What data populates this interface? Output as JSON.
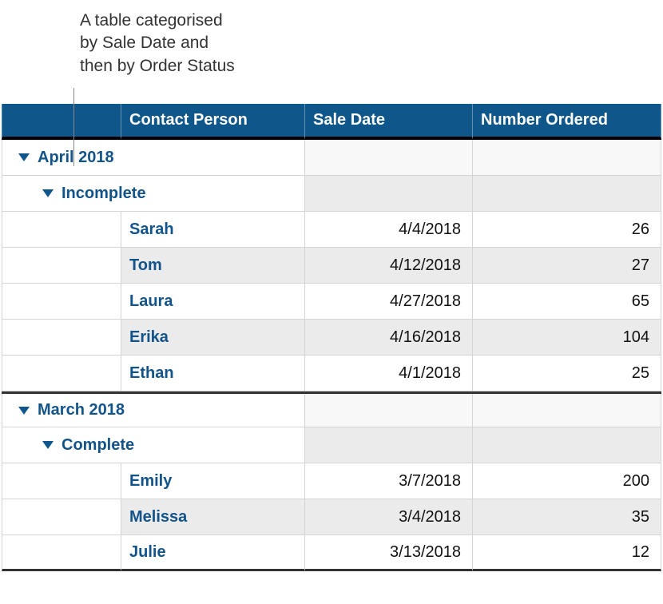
{
  "caption": {
    "line1": "A table categorised",
    "line2": "by Sale Date and",
    "line3": "then by Order Status"
  },
  "columns": {
    "gutter": "",
    "contact": "Contact Person",
    "saleDate": "Sale Date",
    "numberOrdered": "Number Ordered"
  },
  "groups": [
    {
      "label": "April 2018",
      "subgroups": [
        {
          "label": "Incomplete",
          "rows": [
            {
              "contact": "Sarah",
              "date": "4/4/2018",
              "num": "26"
            },
            {
              "contact": "Tom",
              "date": "4/12/2018",
              "num": "27"
            },
            {
              "contact": "Laura",
              "date": "4/27/2018",
              "num": "65"
            },
            {
              "contact": "Erika",
              "date": "4/16/2018",
              "num": "104"
            },
            {
              "contact": "Ethan",
              "date": "4/1/2018",
              "num": "25"
            }
          ]
        }
      ]
    },
    {
      "label": "March 2018",
      "subgroups": [
        {
          "label": "Complete",
          "rows": [
            {
              "contact": "Emily",
              "date": "3/7/2018",
              "num": "200"
            },
            {
              "contact": "Melissa",
              "date": "3/4/2018",
              "num": "35"
            },
            {
              "contact": "Julie",
              "date": "3/13/2018",
              "num": "12"
            }
          ]
        }
      ]
    }
  ]
}
